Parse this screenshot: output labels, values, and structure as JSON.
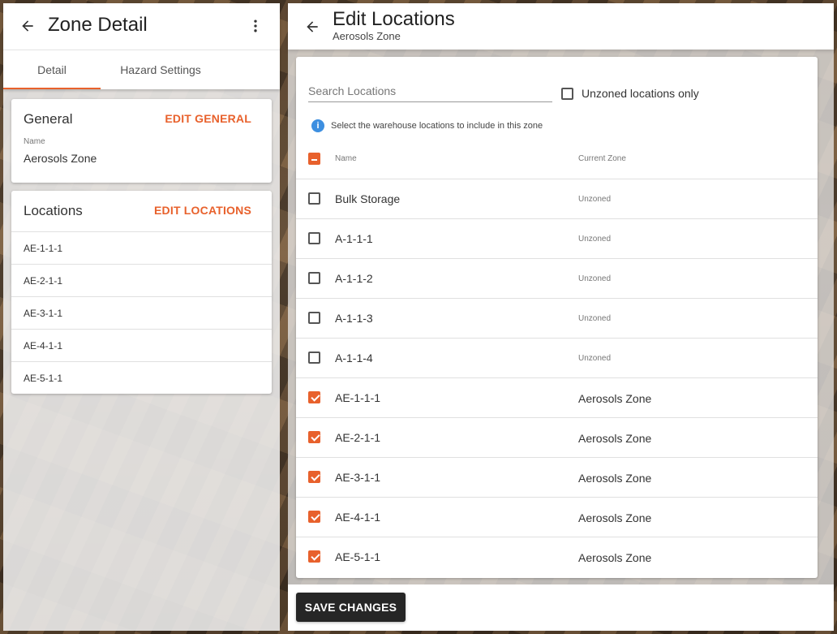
{
  "left": {
    "title": "Zone Detail",
    "tabs": [
      {
        "label": "Detail"
      },
      {
        "label": "Hazard Settings"
      }
    ],
    "general": {
      "title": "General",
      "action": "EDIT GENERAL",
      "name_label": "Name",
      "name_value": "Aerosols Zone"
    },
    "locations": {
      "title": "Locations",
      "action": "EDIT LOCATIONS",
      "items": [
        "AE-1-1-1",
        "AE-2-1-1",
        "AE-3-1-1",
        "AE-4-1-1",
        "AE-5-1-1"
      ]
    }
  },
  "right": {
    "title": "Edit Locations",
    "subtitle": "Aerosols Zone",
    "search": {
      "placeholder": "Search Locations",
      "value": ""
    },
    "unzoned_only": {
      "label": "Unzoned locations only",
      "checked": false
    },
    "info_text": "Select the warehouse locations to include in this zone",
    "columns": {
      "name": "Name",
      "zone": "Current Zone"
    },
    "rows": [
      {
        "name": "Bulk Storage",
        "zone": "Unzoned",
        "checked": false
      },
      {
        "name": "A-1-1-1",
        "zone": "Unzoned",
        "checked": false
      },
      {
        "name": "A-1-1-2",
        "zone": "Unzoned",
        "checked": false
      },
      {
        "name": "A-1-1-3",
        "zone": "Unzoned",
        "checked": false
      },
      {
        "name": "A-1-1-4",
        "zone": "Unzoned",
        "checked": false
      },
      {
        "name": "AE-1-1-1",
        "zone": "Aerosols Zone",
        "checked": true
      },
      {
        "name": "AE-2-1-1",
        "zone": "Aerosols Zone",
        "checked": true
      },
      {
        "name": "AE-3-1-1",
        "zone": "Aerosols Zone",
        "checked": true
      },
      {
        "name": "AE-4-1-1",
        "zone": "Aerosols Zone",
        "checked": true
      },
      {
        "name": "AE-5-1-1",
        "zone": "Aerosols Zone",
        "checked": true
      }
    ],
    "save_label": "SAVE CHANGES"
  },
  "colors": {
    "accent": "#e8612c",
    "info": "#3d8fe0",
    "button": "#262626"
  }
}
